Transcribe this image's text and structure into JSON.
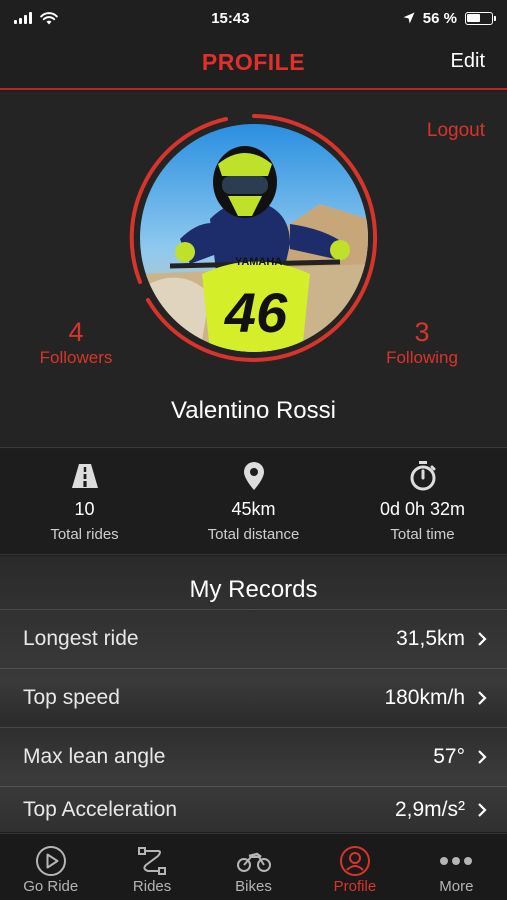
{
  "status_bar": {
    "time": "15:43",
    "battery": "56 %",
    "battery_level": 0.56
  },
  "header": {
    "title": "PROFILE",
    "edit_label": "Edit"
  },
  "profile": {
    "logout_label": "Logout",
    "followers_count": "4",
    "followers_label": "Followers",
    "following_count": "3",
    "following_label": "Following",
    "name": "Valentino Rossi",
    "avatar_bike_brand": "YAMAHA",
    "avatar_bike_number": "46"
  },
  "stats": [
    {
      "icon": "road-icon",
      "value": "10",
      "label": "Total rides"
    },
    {
      "icon": "location-pin-icon",
      "value": "45km",
      "label": "Total distance"
    },
    {
      "icon": "stopwatch-icon",
      "value": "0d 0h 32m",
      "label": "Total time"
    }
  ],
  "records": {
    "title": "My Records",
    "items": [
      {
        "label": "Longest ride",
        "value": "31,5km"
      },
      {
        "label": "Top speed",
        "value": "180km/h"
      },
      {
        "label": "Max lean angle",
        "value": "57°"
      },
      {
        "label": "Top Acceleration",
        "value": "2,9m/s²"
      }
    ]
  },
  "tabs": [
    {
      "label": "Go Ride",
      "icon": "play-circle-icon"
    },
    {
      "label": "Rides",
      "icon": "route-icon"
    },
    {
      "label": "Bikes",
      "icon": "motorcycle-icon"
    },
    {
      "label": "Profile",
      "icon": "profile-icon",
      "active": true
    },
    {
      "label": "More",
      "icon": "more-dots-icon"
    }
  ],
  "colors": {
    "accent": "#d8342b",
    "background": "#1f1f1f"
  }
}
